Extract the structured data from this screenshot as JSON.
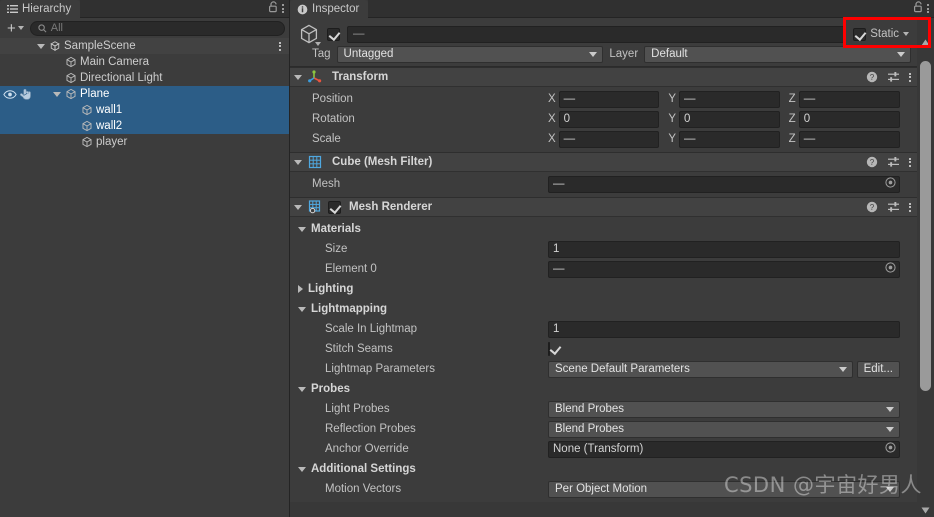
{
  "hierarchy": {
    "tab_label": "Hierarchy",
    "tab_icon": "hierarchy-list-icon",
    "lock_icon": "lock-open-icon",
    "menu_icon": "kebab-menu-icon",
    "toolbar": {
      "add_label": "+",
      "add_icon": "plus-icon",
      "add_caret_icon": "chevron-down-icon",
      "search_icon": "search-icon",
      "search_value": "",
      "search_placeholder": "All"
    },
    "rows": [
      {
        "label": "SampleScene",
        "icon": "unity-scene-icon",
        "depth": 0,
        "twisty": "down",
        "selected": false,
        "is_scene": true,
        "kebab": true,
        "gutter": ""
      },
      {
        "label": "Main Camera",
        "icon": "gameobject-cube-icon",
        "depth": 1,
        "twisty": "none",
        "selected": false,
        "is_scene": false,
        "kebab": false,
        "gutter": ""
      },
      {
        "label": "Directional Light",
        "icon": "gameobject-cube-icon",
        "depth": 1,
        "twisty": "none",
        "selected": false,
        "is_scene": false,
        "kebab": false,
        "gutter": ""
      },
      {
        "label": "Plane",
        "icon": "gameobject-cube-icon",
        "depth": 1,
        "twisty": "down",
        "selected": true,
        "is_scene": false,
        "kebab": false,
        "gutter": "visibility"
      },
      {
        "label": "wall1",
        "icon": "gameobject-cube-icon",
        "depth": 2,
        "twisty": "none",
        "selected": true,
        "is_scene": false,
        "kebab": false,
        "gutter": ""
      },
      {
        "label": "wall2",
        "icon": "gameobject-cube-icon",
        "depth": 2,
        "twisty": "none",
        "selected": true,
        "is_scene": false,
        "kebab": false,
        "gutter": ""
      },
      {
        "label": "player",
        "icon": "gameobject-cube-icon",
        "depth": 2,
        "twisty": "none",
        "selected": false,
        "is_scene": false,
        "kebab": false,
        "gutter": ""
      }
    ]
  },
  "inspector": {
    "tab_label": "Inspector",
    "tab_icon": "info-circle-icon",
    "lock_icon": "lock-open-icon",
    "menu_icon": "kebab-menu-icon",
    "header": {
      "object_icon": "gameobject-cube-icon",
      "enabled_checkbox": true,
      "name_value": "—",
      "static_checkbox": true,
      "static_label": "Static",
      "static_caret_icon": "chevron-down-icon",
      "tag_label": "Tag",
      "tag_value": "Untagged",
      "layer_label": "Layer",
      "layer_value": "Default"
    },
    "components": [
      {
        "title": "Transform",
        "icon": "transform-axis-icon",
        "expanded": true,
        "has_enable_checkbox": false,
        "help_icon": "help-circle-icon",
        "preset_icon": "preset-sliders-icon",
        "menu_icon": "kebab-menu-icon",
        "rows": [
          {
            "kind": "vec3",
            "name": "Position",
            "x": "—",
            "y": "—",
            "z": "—"
          },
          {
            "kind": "vec3",
            "name": "Rotation",
            "x": "0",
            "y": "0",
            "z": "0"
          },
          {
            "kind": "vec3",
            "name": "Scale",
            "x": "—",
            "y": "—",
            "z": "—"
          }
        ]
      },
      {
        "title": "Cube (Mesh Filter)",
        "icon": "mesh-filter-grid-icon",
        "expanded": true,
        "has_enable_checkbox": false,
        "help_icon": "help-circle-icon",
        "preset_icon": "preset-sliders-icon",
        "menu_icon": "kebab-menu-icon",
        "rows": [
          {
            "kind": "object",
            "name": "Mesh",
            "value": "—",
            "picker_icon": "object-picker-icon"
          }
        ]
      },
      {
        "title": "Mesh Renderer",
        "icon": "mesh-renderer-grid-icon",
        "expanded": true,
        "has_enable_checkbox": true,
        "enable_checkbox": true,
        "help_icon": "help-circle-icon",
        "preset_icon": "preset-sliders-icon",
        "menu_icon": "kebab-menu-icon",
        "rows": [
          {
            "kind": "group",
            "name": "Materials",
            "expanded": true
          },
          {
            "kind": "number",
            "name": "Size",
            "value": "1"
          },
          {
            "kind": "object",
            "name": "Element 0",
            "value": "—",
            "picker_icon": "object-picker-icon"
          },
          {
            "kind": "group",
            "name": "Lighting",
            "expanded": false
          },
          {
            "kind": "group",
            "name": "Lightmapping",
            "expanded": true
          },
          {
            "kind": "number",
            "name": "Scale In Lightmap",
            "value": "1"
          },
          {
            "kind": "checkbox",
            "name": "Stitch Seams",
            "value": true
          },
          {
            "kind": "dropdown-edit",
            "name": "Lightmap Parameters",
            "value": "Scene Default Parameters",
            "button": "Edit..."
          },
          {
            "kind": "group",
            "name": "Probes",
            "expanded": true
          },
          {
            "kind": "dropdown",
            "name": "Light Probes",
            "value": "Blend Probes"
          },
          {
            "kind": "dropdown",
            "name": "Reflection Probes",
            "value": "Blend Probes"
          },
          {
            "kind": "object",
            "name": "Anchor Override",
            "value": "None (Transform)",
            "picker_icon": "object-picker-icon"
          },
          {
            "kind": "group",
            "name": "Additional Settings",
            "expanded": true
          },
          {
            "kind": "dropdown",
            "name": "Motion Vectors",
            "value": "Per Object Motion"
          }
        ]
      }
    ],
    "scrollbar": {
      "up_icon": "triangle-up-icon",
      "down_icon": "triangle-down-icon"
    }
  },
  "annotations": {
    "highlight_color": "#fe0000",
    "highlight_target": "static-checkbox"
  },
  "watermark": {
    "text": "CSDN @宇宙好男人"
  }
}
